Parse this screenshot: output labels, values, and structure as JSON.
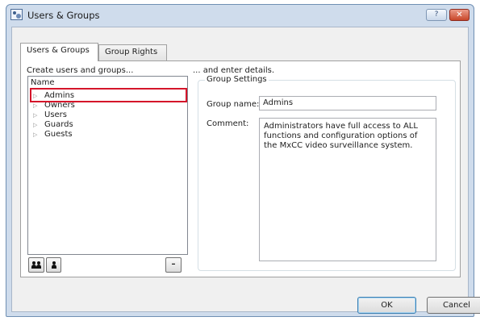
{
  "window": {
    "title": "Users & Groups",
    "help_label": "?",
    "close_label": "✕"
  },
  "tabs": [
    {
      "label": "Users & Groups"
    },
    {
      "label": "Group Rights"
    }
  ],
  "left": {
    "heading": "Create users and groups...",
    "tree_header": "Name",
    "items": [
      {
        "label": "Admins"
      },
      {
        "label": "Owners"
      },
      {
        "label": "Users"
      },
      {
        "label": "Guards"
      },
      {
        "label": "Guests"
      }
    ],
    "remove_label": "–"
  },
  "right": {
    "heading": "... and enter details.",
    "group_title": "Group Settings",
    "group_name_label": "Group name:",
    "group_name_value": "Admins",
    "comment_label": "Comment:",
    "comment_value": "Administrators have full access to ALL functions and configuration options of the MxCC video surveillance system."
  },
  "buttons": {
    "ok": "OK",
    "cancel": "Cancel"
  }
}
